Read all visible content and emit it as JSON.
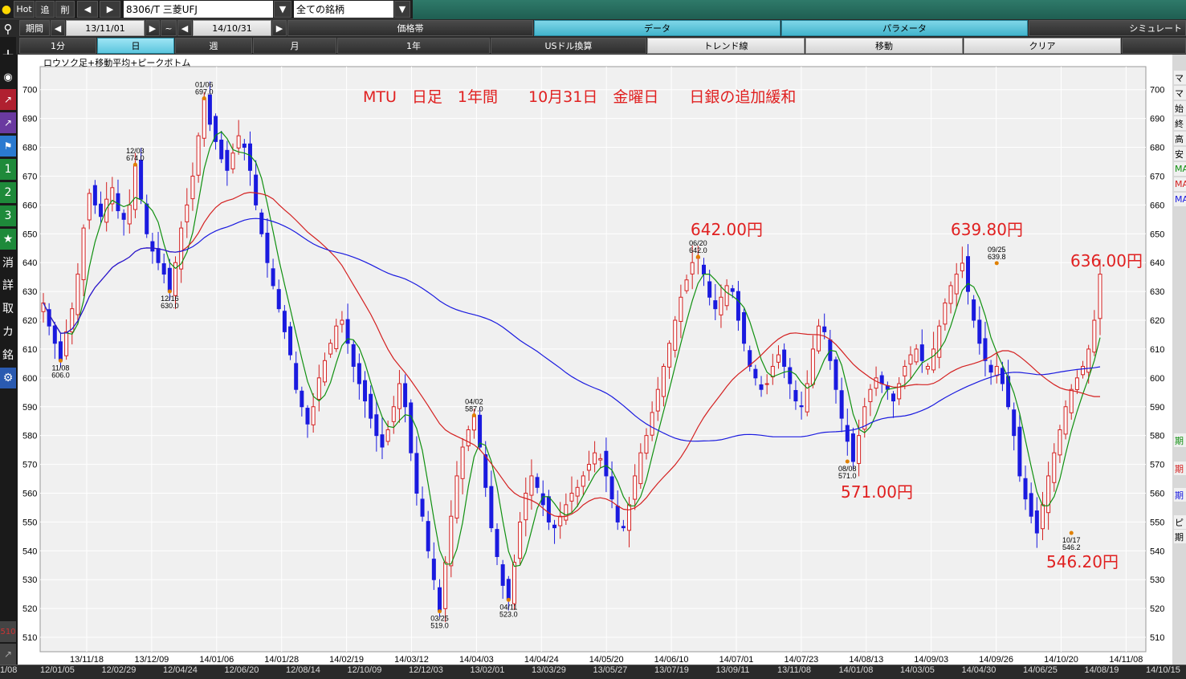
{
  "toolbar": {
    "hot": "Hot",
    "add": "追",
    "del": "削",
    "symbol": "8306/T 三菱UFJ",
    "group": "全ての銘柄"
  },
  "row2": {
    "period_label": "期間",
    "from": "13/11/01",
    "tilde": "~",
    "to": "14/10/31",
    "tab_price": "価格帯",
    "tab_data": "データ",
    "tab_param": "パラメータ",
    "tab_sim": "シミュレート"
  },
  "row3": {
    "b1": "1分",
    "b2": "日",
    "b3": "週",
    "b4": "月",
    "b5": "1年",
    "b6": "USドル換算",
    "b7": "トレンド線",
    "b8": "移動",
    "b9": "クリア"
  },
  "chart_header": "ロウソク足+移動平均+ピークボトム",
  "annotation_title": "MTU　日足　1年間　　10月31日　金曜日　　日銀の追加緩和",
  "red_labels": {
    "l642": "642.00円",
    "l639": "639.80円",
    "l636": "636.00円",
    "l571": "571.00円",
    "l546": "546.20円"
  },
  "left_tools": [
    "消",
    "詳",
    "取",
    "カ",
    "銘"
  ],
  "left_numbers": [
    "1",
    "2",
    "3"
  ],
  "right_panel": [
    "マ",
    "マ",
    "始",
    "終",
    "高",
    "安",
    "MA",
    "MA",
    "MA"
  ],
  "right_panel2": [
    "期",
    "期",
    "期",
    "ピ",
    "期"
  ],
  "colors": {
    "up": "#d42020",
    "down": "#1a1adf",
    "ma_short": "#109010",
    "ma_mid": "#d42020",
    "ma_long": "#1a1adf",
    "accent": "#42b4cc"
  },
  "bottom_timeline": [
    "1/08",
    "12/01/05",
    "12/02/29",
    "12/04/24",
    "12/06/20",
    "12/08/14",
    "12/10/09",
    "12/12/03",
    "13/02/01",
    "13/03/29",
    "13/05/27",
    "13/07/19",
    "13/09/11",
    "13/11/08",
    "14/01/08",
    "14/03/05",
    "14/04/30",
    "14/06/25",
    "14/08/19",
    "14/10/15"
  ],
  "chart_data": {
    "type": "candlestick",
    "ylim": [
      505,
      708
    ],
    "y_ticks": [
      700,
      690,
      680,
      670,
      660,
      650,
      640,
      630,
      620,
      610,
      600,
      590,
      580,
      570,
      560,
      550,
      540,
      530,
      520,
      510
    ],
    "x_tick_labels": [
      "13/11/18",
      "13/12/09",
      "14/01/06",
      "14/01/28",
      "14/02/19",
      "14/03/12",
      "14/04/03",
      "14/04/24",
      "14/05/20",
      "14/06/10",
      "14/07/01",
      "14/07/23",
      "14/08/13",
      "14/09/03",
      "14/09/26",
      "14/10/20",
      "14/11/08"
    ],
    "peaks": [
      {
        "date": "11/08",
        "value": "606.0",
        "price": 606
      },
      {
        "date": "12/03",
        "value": "674.0",
        "price": 674
      },
      {
        "date": "12/16",
        "value": "630.0",
        "price": 630
      },
      {
        "date": "01/06",
        "value": "697.0",
        "price": 697
      },
      {
        "date": "03/25",
        "value": "519.0",
        "price": 519
      },
      {
        "date": "04/02",
        "value": "587.0",
        "price": 587
      },
      {
        "date": "04/11",
        "value": "523.0",
        "price": 523
      },
      {
        "date": "06/20",
        "value": "642.0",
        "price": 642
      },
      {
        "date": "08/08",
        "value": "571.0",
        "price": 571
      },
      {
        "date": "09/25",
        "value": "639.8",
        "price": 639.8
      },
      {
        "date": "10/17",
        "value": "546.2",
        "price": 546.2
      }
    ],
    "close_path": [
      626,
      618,
      612,
      606,
      616,
      624,
      636,
      652,
      664,
      660,
      656,
      662,
      666,
      658,
      655,
      660,
      674,
      662,
      650,
      644,
      640,
      636,
      630,
      640,
      652,
      660,
      670,
      684,
      697,
      688,
      682,
      676,
      672,
      678,
      684,
      680,
      672,
      660,
      650,
      640,
      632,
      624,
      616,
      608,
      596,
      590,
      584,
      590,
      600,
      606,
      612,
      618,
      620,
      612,
      604,
      598,
      592,
      586,
      580,
      576,
      582,
      590,
      598,
      590,
      574,
      560,
      552,
      540,
      530,
      519,
      536,
      552,
      566,
      576,
      582,
      587,
      576,
      562,
      548,
      538,
      528,
      523,
      536,
      550,
      560,
      566,
      562,
      556,
      550,
      548,
      552,
      556,
      560,
      562,
      566,
      570,
      574,
      572,
      566,
      558,
      550,
      548,
      556,
      566,
      574,
      580,
      588,
      596,
      604,
      612,
      620,
      628,
      634,
      640,
      642,
      636,
      628,
      624,
      628,
      632,
      630,
      620,
      612,
      604,
      600,
      596,
      598,
      604,
      608,
      604,
      598,
      592,
      590,
      598,
      610,
      618,
      616,
      606,
      596,
      586,
      578,
      571,
      580,
      590,
      596,
      600,
      598,
      596,
      592,
      598,
      604,
      608,
      610,
      606,
      604,
      610,
      618,
      626,
      632,
      636,
      639.8,
      630,
      620,
      612,
      606,
      602,
      604,
      598,
      590,
      580,
      566,
      558,
      552,
      546.2,
      556,
      566,
      574,
      582,
      590,
      596,
      600,
      604,
      610,
      620,
      636
    ]
  }
}
